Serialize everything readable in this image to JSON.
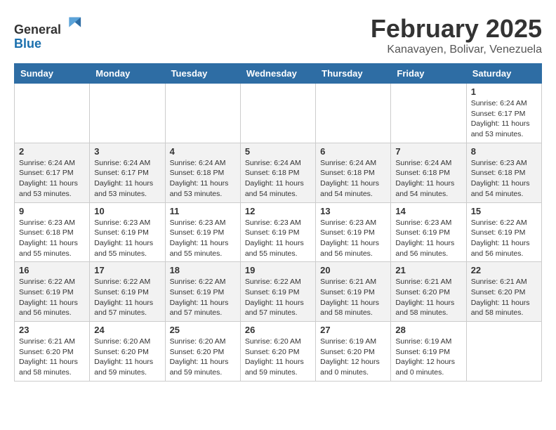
{
  "header": {
    "logo_line1": "General",
    "logo_line2": "Blue",
    "month_year": "February 2025",
    "location": "Kanavayen, Bolivar, Venezuela"
  },
  "weekdays": [
    "Sunday",
    "Monday",
    "Tuesday",
    "Wednesday",
    "Thursday",
    "Friday",
    "Saturday"
  ],
  "weeks": [
    [
      {
        "day": "",
        "info": ""
      },
      {
        "day": "",
        "info": ""
      },
      {
        "day": "",
        "info": ""
      },
      {
        "day": "",
        "info": ""
      },
      {
        "day": "",
        "info": ""
      },
      {
        "day": "",
        "info": ""
      },
      {
        "day": "1",
        "info": "Sunrise: 6:24 AM\nSunset: 6:17 PM\nDaylight: 11 hours\nand 53 minutes."
      }
    ],
    [
      {
        "day": "2",
        "info": "Sunrise: 6:24 AM\nSunset: 6:17 PM\nDaylight: 11 hours\nand 53 minutes."
      },
      {
        "day": "3",
        "info": "Sunrise: 6:24 AM\nSunset: 6:17 PM\nDaylight: 11 hours\nand 53 minutes."
      },
      {
        "day": "4",
        "info": "Sunrise: 6:24 AM\nSunset: 6:18 PM\nDaylight: 11 hours\nand 53 minutes."
      },
      {
        "day": "5",
        "info": "Sunrise: 6:24 AM\nSunset: 6:18 PM\nDaylight: 11 hours\nand 54 minutes."
      },
      {
        "day": "6",
        "info": "Sunrise: 6:24 AM\nSunset: 6:18 PM\nDaylight: 11 hours\nand 54 minutes."
      },
      {
        "day": "7",
        "info": "Sunrise: 6:24 AM\nSunset: 6:18 PM\nDaylight: 11 hours\nand 54 minutes."
      },
      {
        "day": "8",
        "info": "Sunrise: 6:23 AM\nSunset: 6:18 PM\nDaylight: 11 hours\nand 54 minutes."
      }
    ],
    [
      {
        "day": "9",
        "info": "Sunrise: 6:23 AM\nSunset: 6:18 PM\nDaylight: 11 hours\nand 55 minutes."
      },
      {
        "day": "10",
        "info": "Sunrise: 6:23 AM\nSunset: 6:19 PM\nDaylight: 11 hours\nand 55 minutes."
      },
      {
        "day": "11",
        "info": "Sunrise: 6:23 AM\nSunset: 6:19 PM\nDaylight: 11 hours\nand 55 minutes."
      },
      {
        "day": "12",
        "info": "Sunrise: 6:23 AM\nSunset: 6:19 PM\nDaylight: 11 hours\nand 55 minutes."
      },
      {
        "day": "13",
        "info": "Sunrise: 6:23 AM\nSunset: 6:19 PM\nDaylight: 11 hours\nand 56 minutes."
      },
      {
        "day": "14",
        "info": "Sunrise: 6:23 AM\nSunset: 6:19 PM\nDaylight: 11 hours\nand 56 minutes."
      },
      {
        "day": "15",
        "info": "Sunrise: 6:22 AM\nSunset: 6:19 PM\nDaylight: 11 hours\nand 56 minutes."
      }
    ],
    [
      {
        "day": "16",
        "info": "Sunrise: 6:22 AM\nSunset: 6:19 PM\nDaylight: 11 hours\nand 56 minutes."
      },
      {
        "day": "17",
        "info": "Sunrise: 6:22 AM\nSunset: 6:19 PM\nDaylight: 11 hours\nand 57 minutes."
      },
      {
        "day": "18",
        "info": "Sunrise: 6:22 AM\nSunset: 6:19 PM\nDaylight: 11 hours\nand 57 minutes."
      },
      {
        "day": "19",
        "info": "Sunrise: 6:22 AM\nSunset: 6:19 PM\nDaylight: 11 hours\nand 57 minutes."
      },
      {
        "day": "20",
        "info": "Sunrise: 6:21 AM\nSunset: 6:19 PM\nDaylight: 11 hours\nand 58 minutes."
      },
      {
        "day": "21",
        "info": "Sunrise: 6:21 AM\nSunset: 6:20 PM\nDaylight: 11 hours\nand 58 minutes."
      },
      {
        "day": "22",
        "info": "Sunrise: 6:21 AM\nSunset: 6:20 PM\nDaylight: 11 hours\nand 58 minutes."
      }
    ],
    [
      {
        "day": "23",
        "info": "Sunrise: 6:21 AM\nSunset: 6:20 PM\nDaylight: 11 hours\nand 58 minutes."
      },
      {
        "day": "24",
        "info": "Sunrise: 6:20 AM\nSunset: 6:20 PM\nDaylight: 11 hours\nand 59 minutes."
      },
      {
        "day": "25",
        "info": "Sunrise: 6:20 AM\nSunset: 6:20 PM\nDaylight: 11 hours\nand 59 minutes."
      },
      {
        "day": "26",
        "info": "Sunrise: 6:20 AM\nSunset: 6:20 PM\nDaylight: 11 hours\nand 59 minutes."
      },
      {
        "day": "27",
        "info": "Sunrise: 6:19 AM\nSunset: 6:20 PM\nDaylight: 12 hours\nand 0 minutes."
      },
      {
        "day": "28",
        "info": "Sunrise: 6:19 AM\nSunset: 6:19 PM\nDaylight: 12 hours\nand 0 minutes."
      },
      {
        "day": "",
        "info": ""
      }
    ]
  ]
}
